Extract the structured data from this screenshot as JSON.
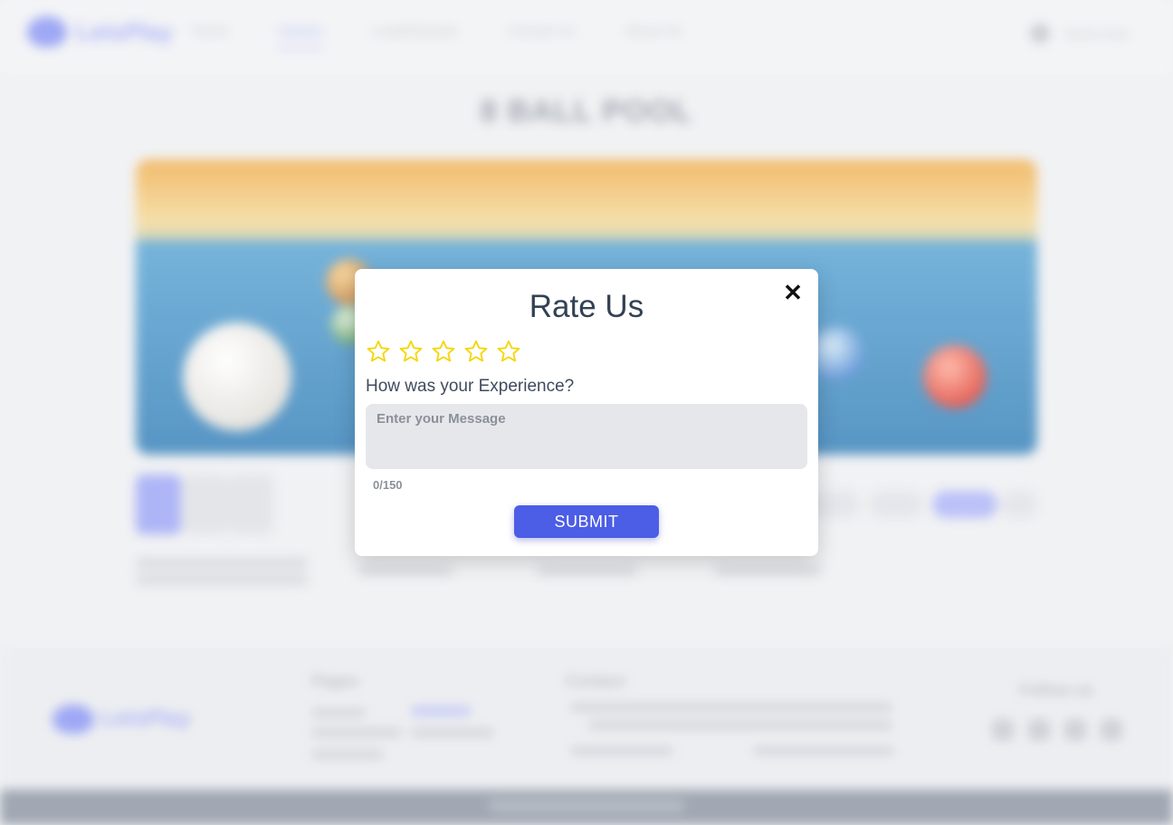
{
  "nav": {
    "brand": "LetsPlay",
    "links": [
      "Home",
      "Games",
      "Leaderboards",
      "Contact Us",
      "About Us"
    ],
    "active_index": 1,
    "user_label": "Guest User"
  },
  "game": {
    "title": "8 BALL POOL"
  },
  "footer": {
    "pages_heading": "Pages",
    "contact_heading": "Contact",
    "follow_heading": "Follow us"
  },
  "modal": {
    "title": "Rate Us",
    "star_count": 5,
    "rating": 0,
    "star_color": "#f5d60a",
    "question": "How was your Experience?",
    "message_placeholder": "Enter your Message",
    "message_value": "",
    "counter": "0/150",
    "submit_label": "SUBMIT",
    "submit_color": "#4c5de6",
    "close_icon": "close-icon"
  }
}
